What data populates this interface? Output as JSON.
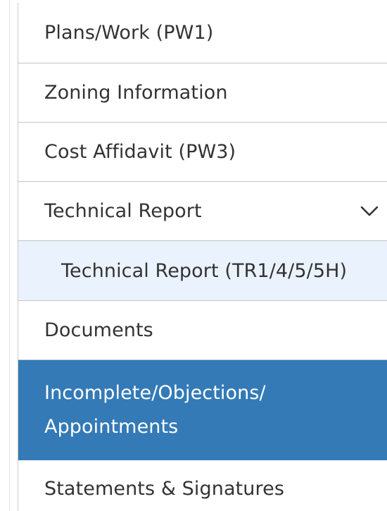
{
  "nav": {
    "items": [
      {
        "label": "Plans/Work (PW1)"
      },
      {
        "label": "Zoning Information"
      },
      {
        "label": "Cost Affidavit (PW3)"
      },
      {
        "label": "Technical Report",
        "expand_icon": "chevron-down-icon"
      },
      {
        "label": "Technical Report (TR1/4/5/5H)"
      },
      {
        "label": "Documents"
      },
      {
        "label": "Incomplete/Objections/ Appointments",
        "state": "active"
      },
      {
        "label": "Statements & Signatures"
      }
    ]
  },
  "colors": {
    "active_bg": "#337ab7",
    "sub_item_bg": "#eaf3fd",
    "text": "#333333",
    "divider": "#c5c5c5"
  }
}
